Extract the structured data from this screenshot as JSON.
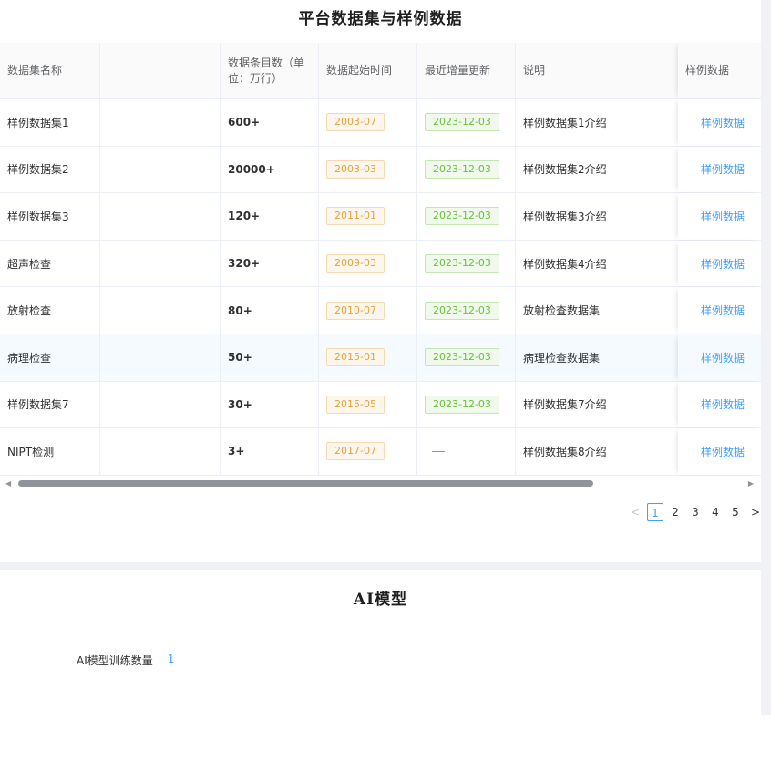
{
  "section1": {
    "title": "平台数据集与样例数据"
  },
  "table": {
    "headers": [
      "数据集名称",
      "",
      "数据条目数（单位：万行）",
      "数据起始时间",
      "最近增量更新",
      "说明",
      "样例数据"
    ],
    "rows": [
      {
        "name": "样例数据集1",
        "count": "600+",
        "start": "2003-07",
        "update": "2023-12-03",
        "desc": "样例数据集1介绍",
        "sample": "样例数据"
      },
      {
        "name": "样例数据集2",
        "count": "20000+",
        "start": "2003-03",
        "update": "2023-12-03",
        "desc": "样例数据集2介绍",
        "sample": "样例数据"
      },
      {
        "name": "样例数据集3",
        "count": "120+",
        "start": "2011-01",
        "update": "2023-12-03",
        "desc": "样例数据集3介绍",
        "sample": "样例数据"
      },
      {
        "name": "超声检查",
        "count": "320+",
        "start": "2009-03",
        "update": "2023-12-03",
        "desc": "样例数据集4介绍",
        "sample": "样例数据"
      },
      {
        "name": "放射检查",
        "count": "80+",
        "start": "2010-07",
        "update": "2023-12-03",
        "desc": "放射检查数据集",
        "sample": "样例数据"
      },
      {
        "name": "病理检查",
        "count": "50+",
        "start": "2015-01",
        "update": "2023-12-03",
        "desc": "病理检查数据集",
        "sample": "样例数据"
      },
      {
        "name": "样例数据集7",
        "count": "30+",
        "start": "2015-05",
        "update": "2023-12-03",
        "desc": "样例数据集7介绍",
        "sample": "样例数据"
      },
      {
        "name": "NIPT检测",
        "count": "3+",
        "start": "2017-07",
        "update": "",
        "desc": "样例数据集8介绍",
        "sample": "样例数据"
      }
    ]
  },
  "pagination": {
    "prev": "<",
    "pages": [
      "1",
      "2",
      "3",
      "4",
      "5"
    ],
    "current": "1",
    "next": ">"
  },
  "section2": {
    "title": "AI模型",
    "label": "AI模型训练数量",
    "value": "1"
  },
  "colors": {
    "accent": "#409eff",
    "tag_orange": "#e6a23c",
    "tag_green": "#67c23a"
  },
  "icons": {
    "scroll_left": "caret-left-icon",
    "scroll_right": "caret-right-icon"
  }
}
